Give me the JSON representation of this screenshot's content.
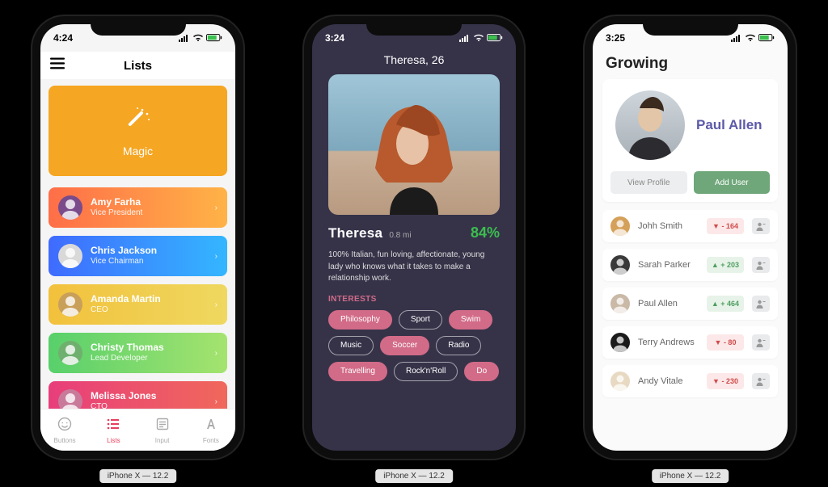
{
  "device_caption": "iPhone X — 12.2",
  "phone1": {
    "time": "4:24",
    "nav_title": "Lists",
    "hero_label": "Magic",
    "people": [
      {
        "name": "Amy Farha",
        "role": "Vice President",
        "gradient": [
          "#FF6E48",
          "#FFB347"
        ]
      },
      {
        "name": "Chris Jackson",
        "role": "Vice Chairman",
        "gradient": [
          "#3F6BFF",
          "#34B6FF"
        ]
      },
      {
        "name": "Amanda Martin",
        "role": "CEO",
        "gradient": [
          "#F2C13C",
          "#EFD860"
        ]
      },
      {
        "name": "Christy Thomas",
        "role": "Lead Developer",
        "gradient": [
          "#58D06B",
          "#A5E36F"
        ]
      },
      {
        "name": "Melissa Jones",
        "role": "CTO",
        "gradient": [
          "#E83E7B",
          "#F0685B"
        ]
      }
    ],
    "tabs": [
      {
        "label": "Buttons",
        "icon": "smiley-icon"
      },
      {
        "label": "Lists",
        "icon": "list-icon"
      },
      {
        "label": "Input",
        "icon": "form-icon"
      },
      {
        "label": "Fonts",
        "icon": "font-icon"
      }
    ],
    "active_tab_index": 1
  },
  "phone2": {
    "time": "3:24",
    "title": "Theresa, 26",
    "name": "Theresa",
    "distance": "0.8 mi",
    "match_pct": "84%",
    "bio": "100% Italian, fun loving, affectionate, young lady who knows what it takes to make a relationship work.",
    "section_label": "INTERESTS",
    "chips": [
      {
        "label": "Philosophy",
        "filled": true
      },
      {
        "label": "Sport",
        "filled": false
      },
      {
        "label": "Swim",
        "filled": true
      },
      {
        "label": "Music",
        "filled": false
      },
      {
        "label": "Soccer",
        "filled": true
      },
      {
        "label": "Radio",
        "filled": false
      },
      {
        "label": "Travelling",
        "filled": true
      },
      {
        "label": "Rock'n'Roll",
        "filled": false
      },
      {
        "label": "Do",
        "filled": true
      }
    ]
  },
  "phone3": {
    "time": "3:25",
    "heading": "Growing",
    "profile_name": "Paul Allen",
    "view_profile_label": "View Profile",
    "add_user_label": "Add User",
    "rows": [
      {
        "name": "Johh Smith",
        "delta": -164
      },
      {
        "name": "Sarah Parker",
        "delta": 203
      },
      {
        "name": "Paul Allen",
        "delta": 464
      },
      {
        "name": "Terry Andrews",
        "delta": -80
      },
      {
        "name": "Andy Vitale",
        "delta": -230
      }
    ]
  }
}
